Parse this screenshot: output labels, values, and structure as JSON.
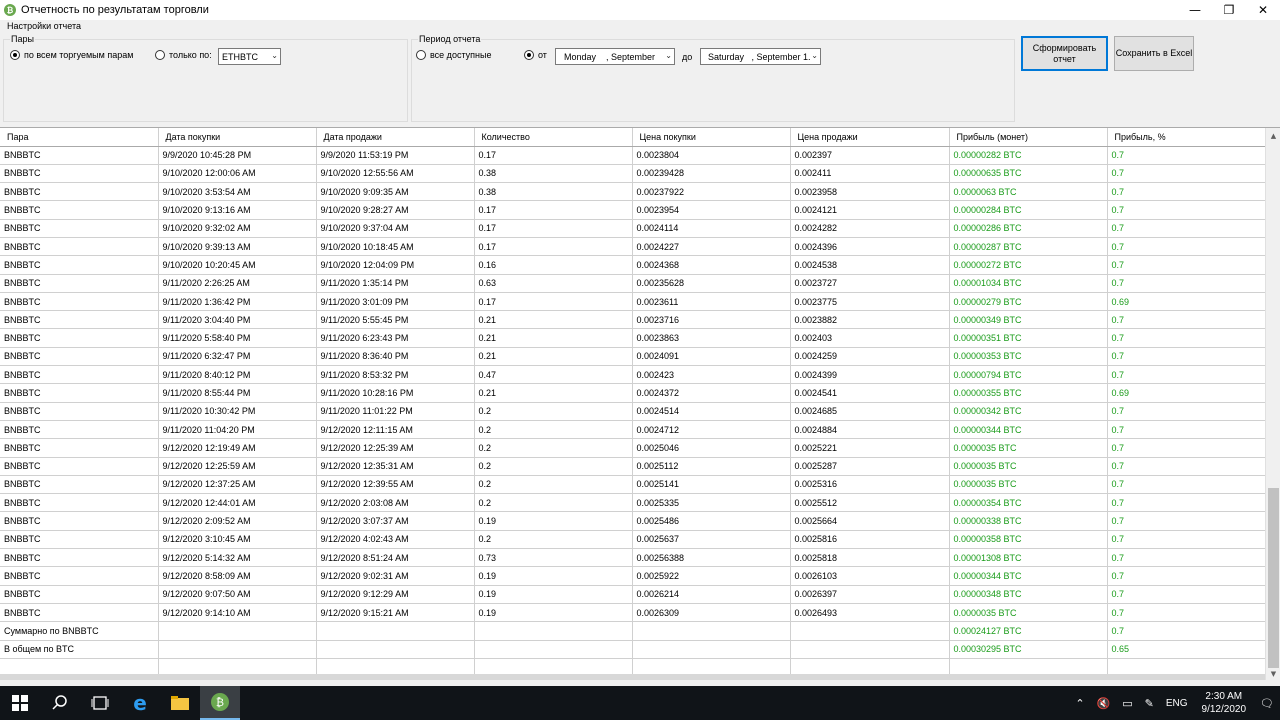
{
  "window": {
    "title": "Отчетность по результатам торговли",
    "minimize_glyph": "—",
    "restore_glyph": "❐",
    "close_glyph": "✕",
    "app_icon": "bitcoin-icon"
  },
  "settings": {
    "section_title": "Настройки отчета",
    "pairs": {
      "title": "Пары",
      "all_label": "по всем торгуемым парам",
      "only_label": "только по:",
      "pair_value": "ETHBTC",
      "selected": "all"
    },
    "period": {
      "title": "Период отчета",
      "all_label": "все доступные",
      "from_label": "от",
      "from_value": "Monday    , September",
      "to_label": "до",
      "to_value": "Saturday   , September 1.",
      "selected": "from"
    },
    "buttons": {
      "generate": "Сформировать отчет",
      "save": "Сохранить в Excel"
    }
  },
  "table": {
    "columns": [
      "Пара",
      "Дата покупки",
      "Дата продажи",
      "Количество",
      "Цена покупки",
      "Цена продажи",
      "Прибыль (монет)",
      "Прибыль, %"
    ],
    "rows": [
      [
        "BNBBTC",
        "9/9/2020 10:45:28 PM",
        "9/9/2020 11:53:19 PM",
        "0.17",
        "0.0023804",
        "0.002397",
        "0.00000282 BTC",
        "0.7"
      ],
      [
        "BNBBTC",
        "9/10/2020 12:00:06 AM",
        "9/10/2020 12:55:56 AM",
        "0.38",
        "0.00239428",
        "0.002411",
        "0.00000635 BTC",
        "0.7"
      ],
      [
        "BNBBTC",
        "9/10/2020 3:53:54 AM",
        "9/10/2020 9:09:35 AM",
        "0.38",
        "0.00237922",
        "0.0023958",
        "0.0000063 BTC",
        "0.7"
      ],
      [
        "BNBBTC",
        "9/10/2020 9:13:16 AM",
        "9/10/2020 9:28:27 AM",
        "0.17",
        "0.0023954",
        "0.0024121",
        "0.00000284 BTC",
        "0.7"
      ],
      [
        "BNBBTC",
        "9/10/2020 9:32:02 AM",
        "9/10/2020 9:37:04 AM",
        "0.17",
        "0.0024114",
        "0.0024282",
        "0.00000286 BTC",
        "0.7"
      ],
      [
        "BNBBTC",
        "9/10/2020 9:39:13 AM",
        "9/10/2020 10:18:45 AM",
        "0.17",
        "0.0024227",
        "0.0024396",
        "0.00000287 BTC",
        "0.7"
      ],
      [
        "BNBBTC",
        "9/10/2020 10:20:45 AM",
        "9/10/2020 12:04:09 PM",
        "0.16",
        "0.0024368",
        "0.0024538",
        "0.00000272 BTC",
        "0.7"
      ],
      [
        "BNBBTC",
        "9/11/2020 2:26:25 AM",
        "9/11/2020 1:35:14 PM",
        "0.63",
        "0.00235628",
        "0.0023727",
        "0.00001034 BTC",
        "0.7"
      ],
      [
        "BNBBTC",
        "9/11/2020 1:36:42 PM",
        "9/11/2020 3:01:09 PM",
        "0.17",
        "0.0023611",
        "0.0023775",
        "0.00000279 BTC",
        "0.69"
      ],
      [
        "BNBBTC",
        "9/11/2020 3:04:40 PM",
        "9/11/2020 5:55:45 PM",
        "0.21",
        "0.0023716",
        "0.0023882",
        "0.00000349 BTC",
        "0.7"
      ],
      [
        "BNBBTC",
        "9/11/2020 5:58:40 PM",
        "9/11/2020 6:23:43 PM",
        "0.21",
        "0.0023863",
        "0.002403",
        "0.00000351 BTC",
        "0.7"
      ],
      [
        "BNBBTC",
        "9/11/2020 6:32:47 PM",
        "9/11/2020 8:36:40 PM",
        "0.21",
        "0.0024091",
        "0.0024259",
        "0.00000353 BTC",
        "0.7"
      ],
      [
        "BNBBTC",
        "9/11/2020 8:40:12 PM",
        "9/11/2020 8:53:32 PM",
        "0.47",
        "0.002423",
        "0.0024399",
        "0.00000794 BTC",
        "0.7"
      ],
      [
        "BNBBTC",
        "9/11/2020 8:55:44 PM",
        "9/11/2020 10:28:16 PM",
        "0.21",
        "0.0024372",
        "0.0024541",
        "0.00000355 BTC",
        "0.69"
      ],
      [
        "BNBBTC",
        "9/11/2020 10:30:42 PM",
        "9/11/2020 11:01:22 PM",
        "0.2",
        "0.0024514",
        "0.0024685",
        "0.00000342 BTC",
        "0.7"
      ],
      [
        "BNBBTC",
        "9/11/2020 11:04:20 PM",
        "9/12/2020 12:11:15 AM",
        "0.2",
        "0.0024712",
        "0.0024884",
        "0.00000344 BTC",
        "0.7"
      ],
      [
        "BNBBTC",
        "9/12/2020 12:19:49 AM",
        "9/12/2020 12:25:39 AM",
        "0.2",
        "0.0025046",
        "0.0025221",
        "0.0000035 BTC",
        "0.7"
      ],
      [
        "BNBBTC",
        "9/12/2020 12:25:59 AM",
        "9/12/2020 12:35:31 AM",
        "0.2",
        "0.0025112",
        "0.0025287",
        "0.0000035 BTC",
        "0.7"
      ],
      [
        "BNBBTC",
        "9/12/2020 12:37:25 AM",
        "9/12/2020 12:39:55 AM",
        "0.2",
        "0.0025141",
        "0.0025316",
        "0.0000035 BTC",
        "0.7"
      ],
      [
        "BNBBTC",
        "9/12/2020 12:44:01 AM",
        "9/12/2020 2:03:08 AM",
        "0.2",
        "0.0025335",
        "0.0025512",
        "0.00000354 BTC",
        "0.7"
      ],
      [
        "BNBBTC",
        "9/12/2020 2:09:52 AM",
        "9/12/2020 3:07:37 AM",
        "0.19",
        "0.0025486",
        "0.0025664",
        "0.00000338 BTC",
        "0.7"
      ],
      [
        "BNBBTC",
        "9/12/2020 3:10:45 AM",
        "9/12/2020 4:02:43 AM",
        "0.2",
        "0.0025637",
        "0.0025816",
        "0.00000358 BTC",
        "0.7"
      ],
      [
        "BNBBTC",
        "9/12/2020 5:14:32 AM",
        "9/12/2020 8:51:24 AM",
        "0.73",
        "0.00256388",
        "0.0025818",
        "0.00001308 BTC",
        "0.7"
      ],
      [
        "BNBBTC",
        "9/12/2020 8:58:09 AM",
        "9/12/2020 9:02:31 AM",
        "0.19",
        "0.0025922",
        "0.0026103",
        "0.00000344 BTC",
        "0.7"
      ],
      [
        "BNBBTC",
        "9/12/2020 9:07:50 AM",
        "9/12/2020 9:12:29 AM",
        "0.19",
        "0.0026214",
        "0.0026397",
        "0.00000348 BTC",
        "0.7"
      ],
      [
        "BNBBTC",
        "9/12/2020 9:14:10 AM",
        "9/12/2020 9:15:21 AM",
        "0.19",
        "0.0026309",
        "0.0026493",
        "0.0000035 BTC",
        "0.7"
      ],
      [
        "Суммарно по BNBBTC",
        "",
        "",
        "",
        "",
        "",
        "0.00024127 BTC",
        "0.7"
      ],
      [
        "В общем по BTC",
        "",
        "",
        "",
        "",
        "",
        "0.00030295 BTC",
        "0.65"
      ],
      [
        "",
        "",
        "",
        "",
        "",
        "",
        "",
        ""
      ]
    ],
    "profit_color": "#1a9c1a"
  },
  "taskbar": {
    "language": "ENG",
    "time": "2:30 AM",
    "date": "9/12/2020",
    "icons": [
      "windows-start-icon",
      "search-icon",
      "task-view-icon",
      "edge-browser-icon",
      "file-explorer-icon",
      "bitcoin-app-icon"
    ]
  }
}
